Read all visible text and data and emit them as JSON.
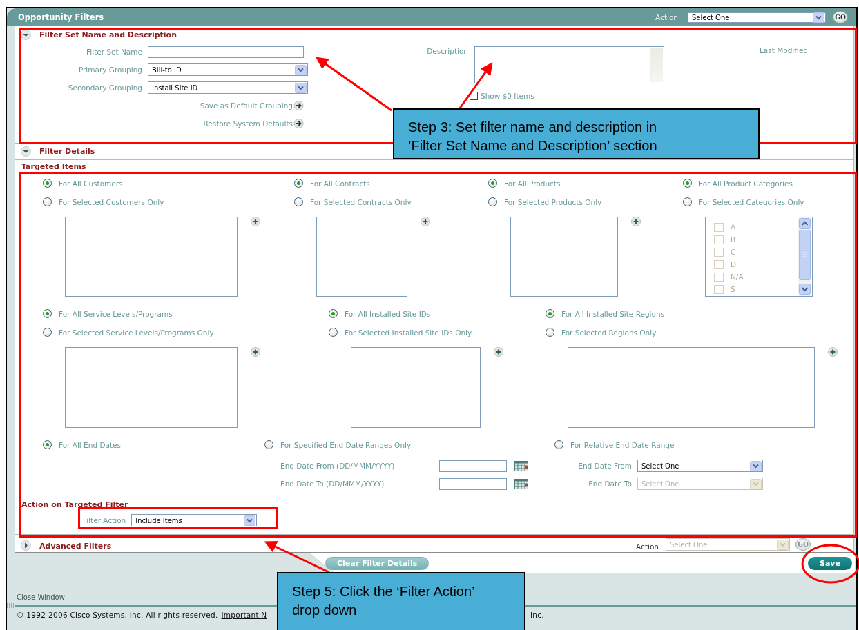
{
  "header": {
    "title": "Opportunity Filters",
    "action_label": "Action",
    "action_select": {
      "value": "Select One",
      "disabled": false
    },
    "go": "GO"
  },
  "filter_set": {
    "title": "Filter Set Name and Description",
    "expanded": true,
    "name_label": "Filter Set Name",
    "primary_label": "Primary Grouping",
    "primary_value": "Bill-to ID",
    "secondary_label": "Secondary Grouping",
    "secondary_value": "Install Site ID",
    "links": [
      "Save as Default Grouping",
      "Restore System Defaults"
    ],
    "description_label": "Description",
    "show_zero": {
      "label": "Show $0 Items",
      "checked": false
    },
    "last_modified_label": "Last Modified"
  },
  "filter_details": {
    "title": "Filter Details",
    "expanded": true
  },
  "targeted_items": {
    "title": "Targeted Items",
    "rows": [
      {
        "groups": [
          {
            "options": [
              {
                "label": "For All Customers",
                "selected": true
              },
              {
                "label": "For Selected Customers Only",
                "selected": false
              }
            ],
            "list": {
              "kind": "blank"
            }
          },
          {
            "options": [
              {
                "label": "For All Contracts",
                "selected": true
              },
              {
                "label": "For Selected Contracts Only",
                "selected": false
              }
            ],
            "list": {
              "kind": "blank"
            }
          },
          {
            "options": [
              {
                "label": "For All Products",
                "selected": true
              },
              {
                "label": "For Selected Products Only",
                "selected": false
              }
            ],
            "list": {
              "kind": "blank"
            }
          },
          {
            "options": [
              {
                "label": "For All Product Categories",
                "selected": true
              },
              {
                "label": "For Selected Categories Only",
                "selected": false
              }
            ],
            "list": {
              "kind": "checklist",
              "items": [
                {
                  "label": "A",
                  "checked": false
                },
                {
                  "label": "B",
                  "checked": false
                },
                {
                  "label": "C",
                  "checked": false
                },
                {
                  "label": "D",
                  "checked": false
                },
                {
                  "label": "N/A",
                  "checked": false
                },
                {
                  "label": "S",
                  "checked": false
                }
              ]
            }
          }
        ]
      },
      {
        "groups": [
          {
            "options": [
              {
                "label": "For All Service Levels/Programs",
                "selected": true
              },
              {
                "label": "For Selected Service Levels/Programs Only",
                "selected": false
              }
            ],
            "list": {
              "kind": "blank"
            }
          },
          {
            "options": [
              {
                "label": "For All Installed Site IDs",
                "selected": true
              },
              {
                "label": "For Selected Installed Site IDs Only",
                "selected": false
              }
            ],
            "list": {
              "kind": "blank"
            }
          },
          {
            "options": [
              {
                "label": "For All Installed Site Regions",
                "selected": true
              },
              {
                "label": "For Selected Regions Only",
                "selected": false
              }
            ],
            "list": {
              "kind": "blank"
            }
          }
        ]
      }
    ]
  },
  "end_dates": {
    "options": [
      {
        "label": "For All End Dates",
        "selected": true
      },
      {
        "label": "For Specified End Date Ranges Only",
        "selected": false
      },
      {
        "label": "For Relative End Date Range",
        "selected": false
      }
    ],
    "range_fields": [
      {
        "label": "End Date From (DD/MMM/YYYY)"
      },
      {
        "label": "End Date To (DD/MMM/YYYY)"
      }
    ],
    "relative_fields": [
      {
        "label": "End Date From",
        "value": "Select One",
        "disabled": false
      },
      {
        "label": "End Date To",
        "value": "Select One",
        "disabled": true
      }
    ]
  },
  "action_on_filter": {
    "title": "Action on Targeted Filter",
    "label": "Filter Action",
    "value": "Include Items"
  },
  "advanced": {
    "title": "Advanced Filters",
    "expanded": false,
    "action_label": "Action",
    "action_select": {
      "value": "Select One",
      "disabled": true
    },
    "go": "GO",
    "go_disabled": true
  },
  "buttons": [
    {
      "label": "Clear Filter Details",
      "kind": "secondary"
    },
    {
      "label": "Save",
      "kind": "primary"
    }
  ],
  "footer": {
    "close": "Close Window",
    "copyright": "© 1992-2006 Cisco Systems, Inc. All rights reserved.",
    "link": "Important N",
    "tail": "Inc."
  },
  "callouts": [
    {
      "text": "Step 3: Set filter name and description in\n’Filter Set Name and Description’ section"
    },
    {
      "text": "Step 5: Click the ‘Filter Action’\ndrop down"
    }
  ]
}
